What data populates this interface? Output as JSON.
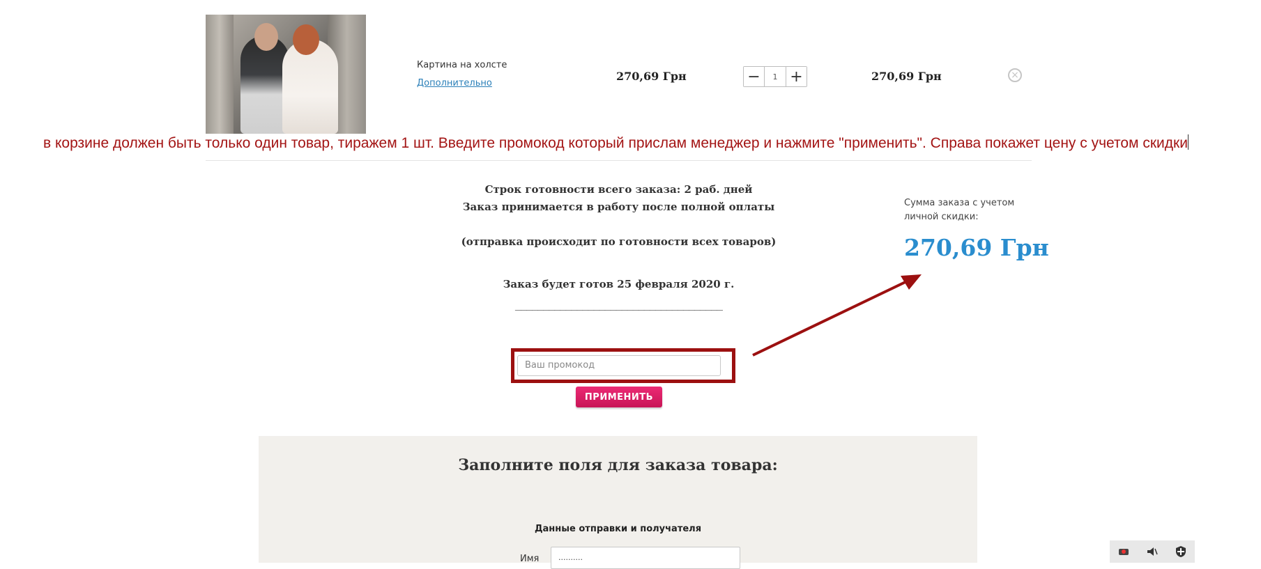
{
  "product": {
    "name": "Картина на холсте",
    "more_link": "Дополнительно",
    "unit_price": "270,69 Грн",
    "quantity": "1",
    "total_price": "270,69 Грн",
    "minus_symbol": "−",
    "plus_symbol": "+",
    "remove_symbol": "×"
  },
  "annotation": {
    "text": "в корзине должен быть только один товар, тиражем 1 шт. Введите промокод который прислам менеджер и нажмите \"применить\". Справа покажет цену с учетом скидки",
    "color": "#a31414"
  },
  "order_info": {
    "line1": "Строк готовности всего заказа: 2 раб. дней",
    "line2": "Заказ принимается в работу после полной оплаты",
    "line3": "(отправка происходит по готовности всех товаров)",
    "line4": "Заказ будет готов 25 февраля 2020 г.",
    "line5": "_____________________________________"
  },
  "summary": {
    "label": "Сумма заказа с учетом личной скидки:",
    "value": "270,69 Грн",
    "color": "#2a8dce"
  },
  "promo": {
    "placeholder": "Ваш промокод",
    "apply_label": "ПРИМЕНИТЬ",
    "button_color": "#e01f69",
    "highlight_color": "#9c1010"
  },
  "form": {
    "title": "Заполните поля для заказа товара:",
    "subtitle": "Данные отправки и получателя",
    "name_label": "Имя",
    "name_value": "..........",
    "background": "#f2f0ec"
  },
  "tray": {
    "icons": [
      "network-icon",
      "speaker-icon",
      "security-shield-icon"
    ]
  }
}
